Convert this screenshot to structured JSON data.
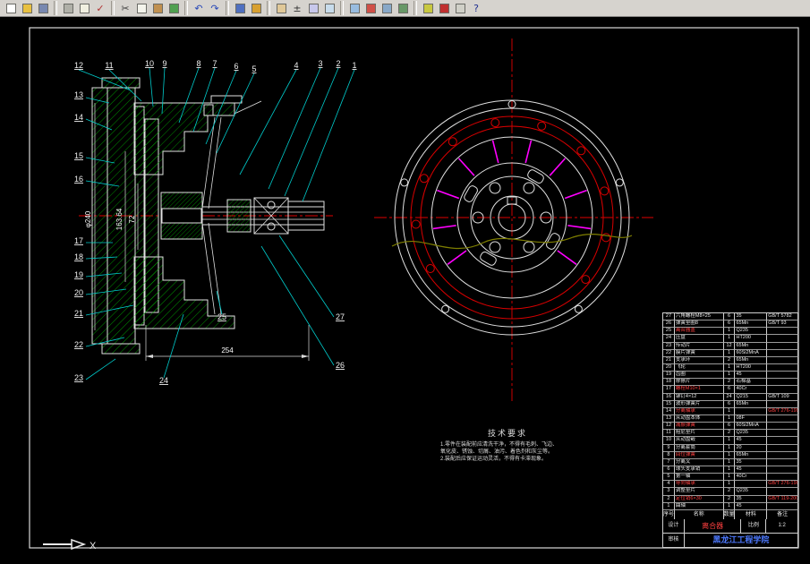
{
  "toolbar": {
    "icons": [
      {
        "name": "new-file-icon",
        "bg": "#ffffff"
      },
      {
        "name": "open-folder-icon",
        "bg": "#e8c040"
      },
      {
        "name": "save-icon",
        "bg": "#7888b0"
      },
      {
        "sep": true
      },
      {
        "name": "print-icon",
        "bg": "#b0b0a8"
      },
      {
        "name": "print-preview-icon",
        "bg": "#f0efe0"
      },
      {
        "name": "spelling-icon",
        "glyph": "✓",
        "fg": "#b03030"
      },
      {
        "sep": true
      },
      {
        "name": "cut-icon",
        "glyph": "✂",
        "fg": "#404040"
      },
      {
        "name": "copy-icon",
        "bg": "#f4f4ec"
      },
      {
        "name": "paste-icon",
        "bg": "#c09050"
      },
      {
        "name": "match-properties-icon",
        "bg": "#50a050"
      },
      {
        "sep": true
      },
      {
        "name": "undo-icon",
        "glyph": "↶",
        "fg": "#2848b8"
      },
      {
        "name": "redo-icon",
        "glyph": "↷",
        "fg": "#2848b8"
      },
      {
        "sep": true
      },
      {
        "name": "insert-hyperlink-icon",
        "bg": "#5070c0"
      },
      {
        "name": "object-snap-icon",
        "bg": "#d8a030"
      },
      {
        "sep": true
      },
      {
        "name": "pan-icon",
        "bg": "#e0c898"
      },
      {
        "name": "zoom-realtime-icon",
        "glyph": "±",
        "fg": "#303030"
      },
      {
        "name": "zoom-window-icon",
        "bg": "#c8c8ec"
      },
      {
        "name": "zoom-previous-icon",
        "bg": "#c8dcec"
      },
      {
        "sep": true
      },
      {
        "name": "distance-icon",
        "bg": "#98bce0"
      },
      {
        "name": "redraw-icon",
        "bg": "#d05048"
      },
      {
        "name": "properties-icon",
        "bg": "#88a8c8"
      },
      {
        "name": "design-center-icon",
        "bg": "#689868"
      },
      {
        "sep": true
      },
      {
        "name": "layer-icon",
        "bg": "#c8c840"
      },
      {
        "name": "color-control-icon",
        "bg": "#c03030"
      },
      {
        "name": "linetype-icon",
        "bg": "#d0d0c8"
      },
      {
        "name": "help-icon",
        "glyph": "?",
        "fg": "#203090"
      }
    ]
  },
  "canvas": {
    "callouts": {
      "c1": "1",
      "c2": "2",
      "c3": "3",
      "c4": "4",
      "c5": "5",
      "c6": "6",
      "c7": "7",
      "c8": "8",
      "c9": "9",
      "c10": "10",
      "c11": "11",
      "c12": "12",
      "c13": "13",
      "c14": "14",
      "c15": "15",
      "c16": "16",
      "c17": "17",
      "c18": "18",
      "c19": "19",
      "c20": "20",
      "c21": "21",
      "c22": "22",
      "c23": "23",
      "c24": "24",
      "c25": "25",
      "c26": "26",
      "c27": "27"
    },
    "dimensions": {
      "width": "254",
      "dia": "φ240",
      "mid": "163.64",
      "inner": "72"
    },
    "tech_req": {
      "title": "技术要求",
      "lines": [
        "1.零件在装配前应清洗干净，不得有毛刺、飞边、",
        "氧化皮、锈蚀、切屑、油污、着色剂和灰尘等。",
        "2.装配后应保证运动灵活，不得有卡滞现象。"
      ]
    },
    "ucs": {
      "x_label": "X"
    }
  },
  "parts_table": {
    "headers": [
      "序号",
      "名称",
      "数量",
      "材料",
      "备注"
    ],
    "rows": [
      {
        "no": "27",
        "name": "六角螺栓M8×25",
        "qty": "6",
        "material": "35",
        "note": "GB/T 5782"
      },
      {
        "no": "26",
        "name": "弹簧垫圈8",
        "qty": "6",
        "material": "65Mn",
        "note": "GB/T 93"
      },
      {
        "no": "25",
        "name": "离合器盖",
        "qty": "1",
        "material": "Q235",
        "note": "",
        "red": true
      },
      {
        "no": "24",
        "name": "压盘",
        "qty": "1",
        "material": "HT200",
        "note": ""
      },
      {
        "no": "23",
        "name": "传动片",
        "qty": "12",
        "material": "65Mn",
        "note": ""
      },
      {
        "no": "22",
        "name": "膜片弹簧",
        "qty": "1",
        "material": "60Si2MnA",
        "note": ""
      },
      {
        "no": "21",
        "name": "支承环",
        "qty": "2",
        "material": "65Mn",
        "note": ""
      },
      {
        "no": "20",
        "name": "飞轮",
        "qty": "1",
        "material": "HT200",
        "note": ""
      },
      {
        "no": "19",
        "name": "齿圈",
        "qty": "1",
        "material": "45",
        "note": ""
      },
      {
        "no": "18",
        "name": "摩擦片",
        "qty": "2",
        "material": "石棉基",
        "note": ""
      },
      {
        "no": "17",
        "name": "螺栓M10×1",
        "qty": "6",
        "material": "40Cr",
        "note": "",
        "red": true
      },
      {
        "no": "16",
        "name": "铆钉4×12",
        "qty": "24",
        "material": "Q215",
        "note": "GB/T 109"
      },
      {
        "no": "15",
        "name": "波形弹簧片",
        "qty": "6",
        "material": "65Mn",
        "note": ""
      },
      {
        "no": "14",
        "name": "分离轴承",
        "qty": "1",
        "material": "",
        "note": "GB/T 276-1994",
        "red": true
      },
      {
        "no": "13",
        "name": "从动盘本体",
        "qty": "1",
        "material": "08F",
        "note": ""
      },
      {
        "no": "12",
        "name": "减振弹簧",
        "qty": "6",
        "material": "60Si2MnA",
        "note": "",
        "red": true
      },
      {
        "no": "11",
        "name": "阻尼垫片",
        "qty": "2",
        "material": "Q235",
        "note": ""
      },
      {
        "no": "10",
        "name": "从动盘毂",
        "qty": "1",
        "material": "45",
        "note": ""
      },
      {
        "no": "9",
        "name": "分离套筒",
        "qty": "1",
        "material": "20",
        "note": ""
      },
      {
        "no": "8",
        "name": "回位弹簧",
        "qty": "1",
        "material": "65Mn",
        "note": "",
        "red": true
      },
      {
        "no": "7",
        "name": "分离叉",
        "qty": "1",
        "material": "35",
        "note": ""
      },
      {
        "no": "6",
        "name": "球头支承销",
        "qty": "1",
        "material": "45",
        "note": ""
      },
      {
        "no": "5",
        "name": "第一轴",
        "qty": "1",
        "material": "40Cr",
        "note": ""
      },
      {
        "no": "4",
        "name": "导向轴承",
        "qty": "1",
        "material": "",
        "note": "GB/T 276-1994",
        "red": true
      },
      {
        "no": "3",
        "name": "调整垫片",
        "qty": "2",
        "material": "Q235",
        "note": ""
      },
      {
        "no": "2",
        "name": "定位销6×30",
        "qty": "2",
        "material": "35",
        "note": "GB/T 119-2000",
        "red": true
      },
      {
        "no": "1",
        "name": "曲轴",
        "qty": "1",
        "material": "45",
        "note": ""
      }
    ]
  },
  "title_block": {
    "design_label": "设计",
    "check_label": "审核",
    "drawing_title": "离合器",
    "scale_label": "比例",
    "scale": "1:2",
    "school": "黑龙江工程学院"
  }
}
